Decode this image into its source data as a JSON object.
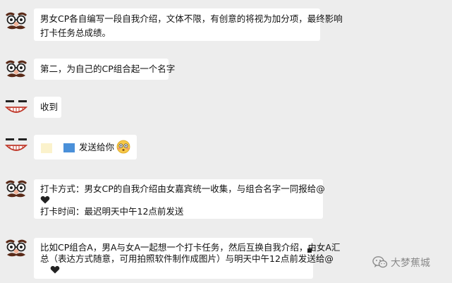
{
  "messages": [
    {
      "avatar": "groucho-glasses-mustache-avatar",
      "lines": [
        "男女CP各自编写一段自我介绍，文体不限，有创意的将视为加分项，最终影响",
        "打卡任务总成绩。"
      ]
    },
    {
      "avatar": "groucho-glasses-mustache-avatar",
      "lines": [
        "第二，为自己的CP组合起一个名字"
      ]
    },
    {
      "avatar": "grinning-face-avatar",
      "lines": [
        "收到"
      ]
    },
    {
      "avatar": "grinning-face-avatar",
      "text": "发送给你",
      "emoji": "flushed-face-emoji"
    },
    {
      "avatar": "groucho-glasses-mustache-avatar",
      "lines": [
        "打卡方式：男女CP的自我介绍由女嘉宾统一收集，与组合名字一同报给@",
        "打卡时间：最迟明天中午12点前发送"
      ],
      "icon": "black-heart-icon"
    },
    {
      "avatar": "groucho-glasses-mustache-avatar",
      "lines": [
        "比如CP组合A，男A与女A一起想一个打卡任务，然后互换自我介绍，由女A汇",
        "总（表达方式随意，可用拍照软件制作成图片）与明天中午12点前发送给@"
      ],
      "icon": "black-heart-icon"
    }
  ],
  "watermark": {
    "text": "大梦蕉城",
    "icon": "wechat-official-account-icon"
  },
  "colors": {
    "background": "#ededed",
    "bubble": "#ffffff",
    "text": "#111111",
    "watermark": "#8a8a8a"
  }
}
